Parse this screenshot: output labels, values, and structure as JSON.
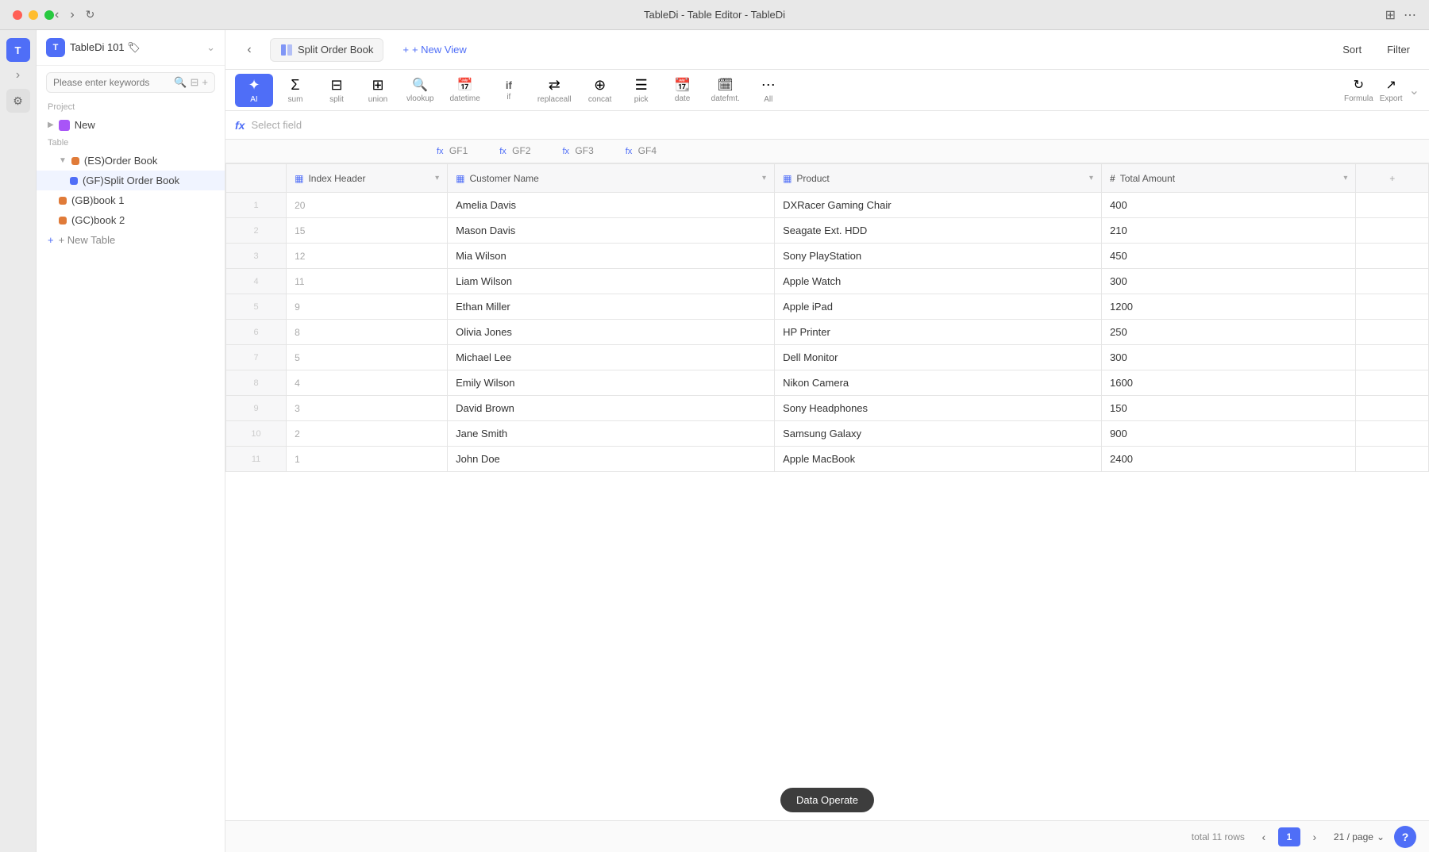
{
  "titlebar": {
    "title": "TableDi - Table Editor - TableDi"
  },
  "sidebar": {
    "search_placeholder": "Please enter keywords",
    "project_label": "Project",
    "table_label": "Table",
    "workspace_name": "TableDi 101 🏷",
    "new_item": "New",
    "tables": [
      {
        "id": "order-book",
        "prefix": "(ES)",
        "name": "Order Book",
        "color": "#e07b39"
      },
      {
        "id": "split-order-book",
        "prefix": "(GF)",
        "name": "Split Order Book",
        "color": "#4f6ef7",
        "active": true
      },
      {
        "id": "book1",
        "prefix": "(GB)",
        "name": "book 1",
        "color": "#e07b39"
      },
      {
        "id": "book2",
        "prefix": "(GC)",
        "name": "book 2",
        "color": "#e07b39"
      }
    ],
    "new_table_label": "+ New Table"
  },
  "toolbar": {
    "view_name": "Split Order Book",
    "new_view": "+ New View",
    "sort_label": "Sort",
    "filter_label": "Filter",
    "tools": [
      {
        "id": "ai",
        "icon": "✦",
        "label": "AI",
        "active": true
      },
      {
        "id": "sum",
        "icon": "Σ",
        "label": "sum"
      },
      {
        "id": "split",
        "icon": "⊟",
        "label": "split"
      },
      {
        "id": "union",
        "icon": "⊞",
        "label": "union"
      },
      {
        "id": "vlookup",
        "icon": "🔍",
        "label": "vlookup"
      },
      {
        "id": "datetime",
        "icon": "📅",
        "label": "datetime"
      },
      {
        "id": "if",
        "icon": "if",
        "label": "if"
      },
      {
        "id": "replaceall",
        "icon": "⇄",
        "label": "replaceall"
      },
      {
        "id": "concat",
        "icon": "⊕",
        "label": "concat"
      },
      {
        "id": "pick",
        "icon": "☰",
        "label": "pick"
      },
      {
        "id": "date",
        "icon": "📆",
        "label": "date"
      },
      {
        "id": "datefmt",
        "icon": "🗓",
        "label": "datefmt."
      },
      {
        "id": "all",
        "icon": "⋯",
        "label": "All"
      }
    ],
    "formula_label": "Formula",
    "export_label": "Export",
    "select_field": "Select field"
  },
  "gf_tabs": [
    {
      "id": "gf1",
      "label": "GF1"
    },
    {
      "id": "gf2",
      "label": "GF2"
    },
    {
      "id": "gf3",
      "label": "GF3"
    },
    {
      "id": "gf4",
      "label": "GF4"
    }
  ],
  "table": {
    "columns": [
      {
        "id": "index",
        "icon": "▦",
        "label": "Index Header",
        "type": "grid",
        "has_dropdown": true
      },
      {
        "id": "customer",
        "icon": "▦",
        "label": "Customer Name",
        "type": "grid",
        "has_dropdown": true
      },
      {
        "id": "product",
        "icon": "▦",
        "label": "Product",
        "type": "grid",
        "has_dropdown": true
      },
      {
        "id": "total",
        "icon": "#",
        "label": "Total Amount",
        "type": "hash",
        "has_dropdown": true
      }
    ],
    "rows": [
      {
        "index": 20,
        "customer": "Amelia Davis",
        "product": "DXRacer Gaming Chair",
        "total": 400
      },
      {
        "index": 15,
        "customer": "Mason Davis",
        "product": "Seagate Ext. HDD",
        "total": 210
      },
      {
        "index": 12,
        "customer": "Mia Wilson",
        "product": "Sony PlayStation",
        "total": 450
      },
      {
        "index": 11,
        "customer": "Liam Wilson",
        "product": "Apple Watch",
        "total": 300
      },
      {
        "index": 9,
        "customer": "Ethan Miller",
        "product": "Apple iPad",
        "total": 1200
      },
      {
        "index": 8,
        "customer": "Olivia Jones",
        "product": "HP Printer",
        "total": 250
      },
      {
        "index": 5,
        "customer": "Michael Lee",
        "product": "Dell Monitor",
        "total": 300
      },
      {
        "index": 4,
        "customer": "Emily Wilson",
        "product": "Nikon Camera",
        "total": 1600
      },
      {
        "index": 3,
        "customer": "David Brown",
        "product": "Sony Headphones",
        "total": 150
      },
      {
        "index": 2,
        "customer": "Jane Smith",
        "product": "Samsung Galaxy",
        "total": 900
      },
      {
        "index": 1,
        "customer": "John Doe",
        "product": "Apple MacBook",
        "total": 2400
      }
    ]
  },
  "footer": {
    "total_label": "total 11 rows",
    "page_current": "1",
    "per_page": "21 / page"
  },
  "data_operate": "Data Operate"
}
